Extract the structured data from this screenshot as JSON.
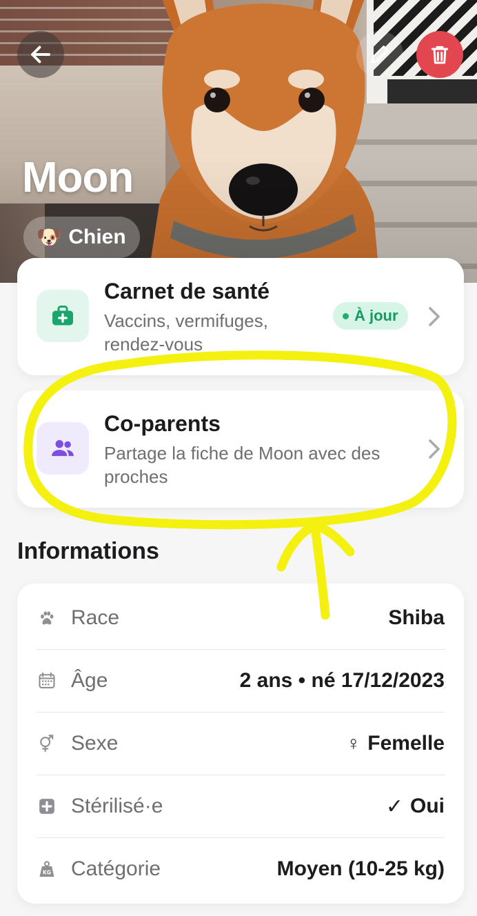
{
  "pet": {
    "name": "Moon",
    "species_emoji": "🐶",
    "species": "Chien"
  },
  "health": {
    "title": "Carnet de santé",
    "subtitle": "Vaccins, vermifuges, rendez-vous",
    "status": "À jour"
  },
  "coparents": {
    "title": "Co-parents",
    "subtitle": "Partage la fiche de Moon avec des proches"
  },
  "informations": {
    "title": "Informations",
    "rows": [
      {
        "icon": "paw-icon",
        "label": "Race",
        "value": "Shiba"
      },
      {
        "icon": "calendar-icon",
        "label": "Âge",
        "value": "2 ans • né 17/12/2023"
      },
      {
        "icon": "gender-icon",
        "label": "Sexe",
        "value_symbol": "♀",
        "value": "Femelle"
      },
      {
        "icon": "sterilized-icon",
        "label": "Stérilisé·e",
        "value_symbol": "✓",
        "value": "Oui"
      },
      {
        "icon": "weight-icon",
        "label": "Catégorie",
        "value": "Moyen (10-25 kg)"
      }
    ]
  },
  "colors": {
    "delete": "#e2474f",
    "status_bg": "#d6f5e6",
    "status_fg": "#179a5f",
    "health_icon": "#1aa56c",
    "coparent_icon": "#7c4de0",
    "annotation": "#f4f010"
  }
}
